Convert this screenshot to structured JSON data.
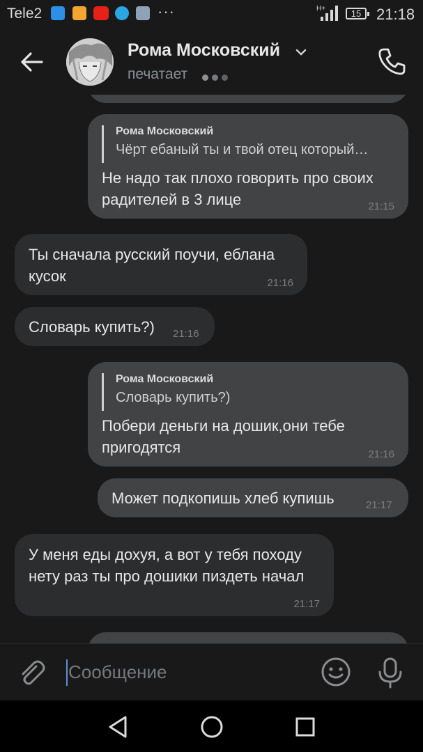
{
  "status_bar": {
    "carrier": "Tele2",
    "more": "···",
    "network": "H+",
    "battery": "15",
    "time": "21:18"
  },
  "header": {
    "name": "Рома Московский",
    "status": "печатает"
  },
  "messages": [
    {
      "id": "m1",
      "direction": "out",
      "reply": {
        "author": "Рома Московский",
        "text": "Чёрт ебаный ты и твой отец который…"
      },
      "text": "Не надо так плохо говорить про своих радителей в 3 лице",
      "time": "21:15"
    },
    {
      "id": "m2",
      "direction": "in",
      "text": "Ты сначала русский поучи, еблана кусок",
      "time": "21:16"
    },
    {
      "id": "m3",
      "direction": "in",
      "text": "Словарь купить?)",
      "time": "21:16"
    },
    {
      "id": "m4",
      "direction": "out",
      "reply": {
        "author": "Рома Московский",
        "text": "Словарь купить?)"
      },
      "text": "Побери деньги на дошик,они тебе пригодятся",
      "time": "21:16"
    },
    {
      "id": "m5",
      "direction": "out",
      "text": "Может подкопишь хлеб купишь",
      "time": "21:17"
    },
    {
      "id": "m6",
      "direction": "in",
      "text": "У меня еды дохуя, а вот у тебя походу нету раз ты про дошики пиздеть начал",
      "time": "21:17"
    }
  ],
  "composer": {
    "placeholder": "Сообщение"
  },
  "colors": {
    "background": "#19191a",
    "outgoing_bubble": "#424345",
    "incoming_bubble": "#2c2d2e",
    "accent": "#5e8fd8"
  },
  "icons": {
    "back": "arrow-left-icon",
    "call": "phone-icon",
    "attach": "paperclip-icon",
    "emoji": "smile-icon",
    "mic": "microphone-icon"
  }
}
